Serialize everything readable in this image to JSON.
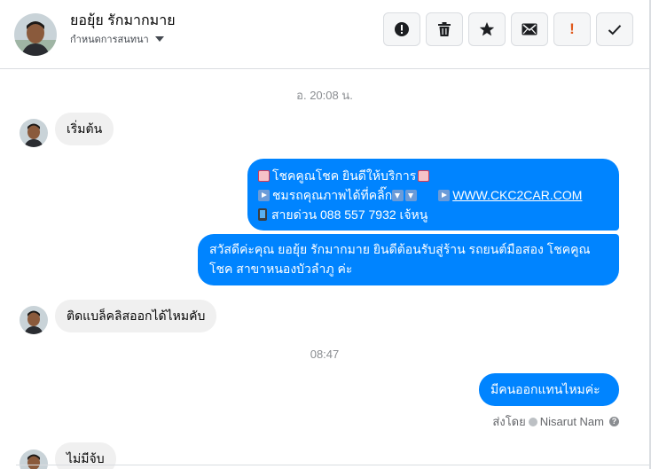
{
  "header": {
    "contact_name": "ยอยุ้ย รักมากมาย",
    "assign_label": "กำหนดการสนทนา",
    "actions": [
      {
        "icon": "spam-alert-icon"
      },
      {
        "icon": "trash-icon"
      },
      {
        "icon": "star-icon"
      },
      {
        "icon": "envelope-icon"
      },
      {
        "icon": "follow-up-icon",
        "glyph": "!"
      },
      {
        "icon": "checkmark-icon"
      }
    ]
  },
  "conversation": {
    "time_1": "อ. 20:08 น.",
    "msg_in_1": "เริ่มต้น",
    "msg_out_1": {
      "line1": "โชคคูณโชค ยินดีให้บริการ",
      "line2": "ชมรถคุณภาพได้ที่คลิ๊ก",
      "link": "WWW.CKC2CAR.COM",
      "line3": "สายด่วน 088 557 7932 เจ้หนู"
    },
    "msg_out_2": "สวัสดีค่ะคุณ ยอยุ้ย รักมากมาย ยินดีต้อนรับสู่ร้าน รถยนต์มือสอง โชคคูณโชค สาขาหนองบัวลำภู ค่ะ",
    "msg_in_2": "ติดแบล็คลิสออกได้ไหมคับ",
    "time_2": "08:47",
    "msg_out_3": "มีคนออกแทนไหมค่ะ",
    "sent_by_label": "ส่งโดย",
    "sent_by_name": "Nisarut Nam",
    "msg_in_3_partial": "ไม่มีจ้บ"
  },
  "colors": {
    "outgoing_bubble": "#0084ff",
    "incoming_bubble": "#f0f0f0",
    "follow_up": "#e0591c"
  }
}
